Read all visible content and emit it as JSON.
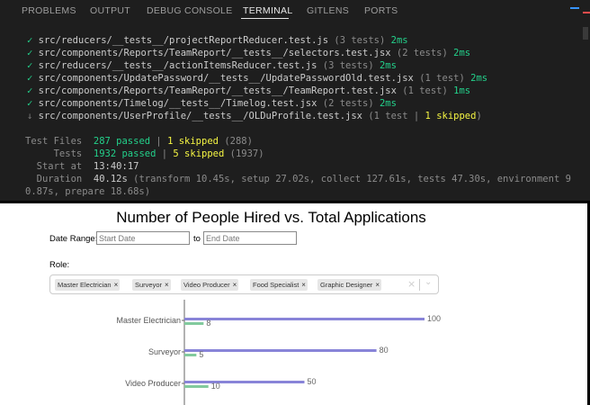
{
  "panel": {
    "tabs": [
      "PROBLEMS",
      "OUTPUT",
      "DEBUG CONSOLE",
      "TERMINAL",
      "GITLENS",
      "PORTS"
    ],
    "active_tab": "TERMINAL",
    "lines": [
      {
        "mark": "✓",
        "path": "src/reducers/__tests__/projectReportReducer.test.js",
        "count": "(3 tests)",
        "time": "2ms"
      },
      {
        "mark": "✓",
        "path": "src/components/Reports/TeamReport/__tests__/selectors.test.jsx",
        "count": "(2 tests)",
        "time": "2ms"
      },
      {
        "mark": "✓",
        "path": "src/reducers/__tests__/actionItemsReducer.test.js",
        "count": "(3 tests)",
        "time": "2ms"
      },
      {
        "mark": "✓",
        "path": "src/components/UpdatePassword/__tests__/UpdatePasswordOld.test.jsx",
        "count": "(1 test)",
        "time": "2ms"
      },
      {
        "mark": "✓",
        "path": "src/components/Reports/TeamReport/__tests__/TeamReport.test.jsx",
        "count": "(1 test)",
        "time": "1ms"
      },
      {
        "mark": "✓",
        "path": "src/components/Timelog/__tests__/Timelog.test.jsx",
        "count": "(2 tests)",
        "time": "2ms"
      }
    ],
    "skipped_line": {
      "mark": "↓",
      "path": "src/components/UserProfile/__tests__/OLDuProfile.test.jsx",
      "count_open": "(1 test |",
      "skipped": "1 skipped",
      "count_close": ")"
    },
    "summary": {
      "test_files_label": "Test Files",
      "test_files_passed": "287 passed",
      "test_files_skipped": "1 skipped",
      "test_files_total": "(288)",
      "tests_label": "Tests",
      "tests_passed": "1932 passed",
      "tests_skipped": "5 skipped",
      "tests_total": "(1937)",
      "start_label": "Start at",
      "start_value": "13:40:17",
      "duration_label": "Duration",
      "duration_value": "40.12s",
      "duration_detail_1": "(transform 10.45s, setup 27.02s, collect 127.61s, tests 47.30s, environment 9",
      "duration_detail_2": "0.87s, prepare 18.68s)"
    },
    "sep": "|"
  },
  "app": {
    "title": "Number of People Hired vs. Total Applications",
    "date_range_label": "Date Range:",
    "start_placeholder": "Start Date",
    "to_label": "to",
    "end_placeholder": "End Date",
    "role_label": "Role:",
    "chips": [
      "Master Electrician",
      "Surveyor",
      "Video Producer",
      "Food Specialist",
      "Graphic Designer"
    ],
    "chip_remove": "×",
    "clear_icon": "×",
    "dropdown_icon": "⌄"
  },
  "chart_data": {
    "type": "bar",
    "orientation": "horizontal",
    "categories": [
      "Master Electrician",
      "Surveyor",
      "Video Producer"
    ],
    "series": [
      {
        "values": [
          100,
          80,
          50
        ],
        "color": "#8884d8"
      },
      {
        "values": [
          8,
          5,
          10
        ],
        "color": "#82ca9d"
      }
    ],
    "xlim": [
      0,
      100
    ]
  }
}
